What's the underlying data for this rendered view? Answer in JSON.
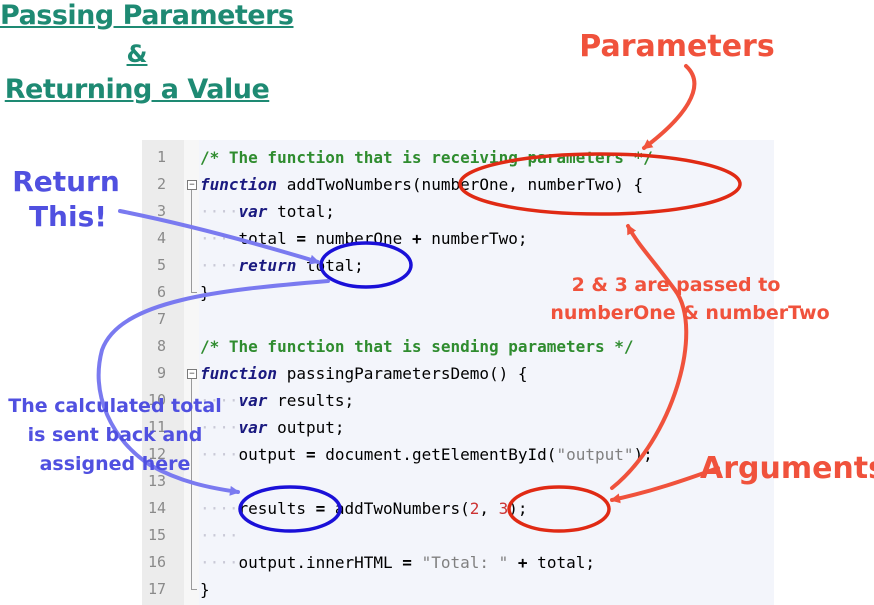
{
  "title": {
    "line1": "Passing Parameters",
    "line2": "&",
    "line3": "Returning a Value"
  },
  "colors": {
    "title": "#1e8a73",
    "parameters_annotation": "#f0523c",
    "return_annotation": "#5050e0",
    "ellipse_red": "#e02a14",
    "ellipse_blue": "#1a10d8"
  },
  "line_numbers": [
    "1",
    "2",
    "3",
    "4",
    "5",
    "6",
    "7",
    "8",
    "9",
    "10",
    "11",
    "12",
    "13",
    "14",
    "15",
    "16",
    "17"
  ],
  "code": {
    "l1_comment": "/* The function that is receiving parameters */",
    "l2_kw": "function",
    "l2_rest": " addTwoNumbers(numberOne, numberTwo) {",
    "l3_indent": "····",
    "l3_kw": "var",
    "l3_rest": " total;",
    "l4_indent": "····",
    "l4_rest_a": "total ",
    "l4_op1": "=",
    "l4_rest_b": " numberOne ",
    "l4_op2": "+",
    "l4_rest_c": " numberTwo;",
    "l5_indent": "····",
    "l5_kw": "return",
    "l5_rest": " total;",
    "l6_text": "}",
    "l8_comment": "/* The function that is sending parameters */",
    "l9_kw": "function",
    "l9_rest": " passingParametersDemo() {",
    "l10_indent": "····",
    "l10_kw": "var",
    "l10_rest": " results;",
    "l11_indent": "····",
    "l11_kw": "var",
    "l11_rest": " output;",
    "l12_indent": "····",
    "l12_rest_a": "output ",
    "l12_op": "=",
    "l12_rest_b": " document.getElementById(",
    "l12_str": "\"output\"",
    "l12_rest_c": ");",
    "l14_indent": "····",
    "l14_rest_a": "results ",
    "l14_op": "=",
    "l14_rest_b": " addTwoNumbers(",
    "l14_num1": "2",
    "l14_comma": ", ",
    "l14_num2": "3",
    "l14_rest_c": ");",
    "l15_indent": "····",
    "l16_indent": "····",
    "l16_rest_a": "output.innerHTML ",
    "l16_op1": "=",
    "l16_str": " \"Total: \" ",
    "l16_op2": "+",
    "l16_rest_b": " total;",
    "l17_text": "}"
  },
  "annotations": {
    "parameters": "Parameters",
    "arguments": "Arguments",
    "passed_line1": "2 & 3 are passed to",
    "passed_line2": "numberOne & numberTwo",
    "return_line1": "Return",
    "return_line2": "This!",
    "sent_back_line1": "The calculated total",
    "sent_back_line2": "is sent back and",
    "sent_back_line3": "assigned here"
  }
}
